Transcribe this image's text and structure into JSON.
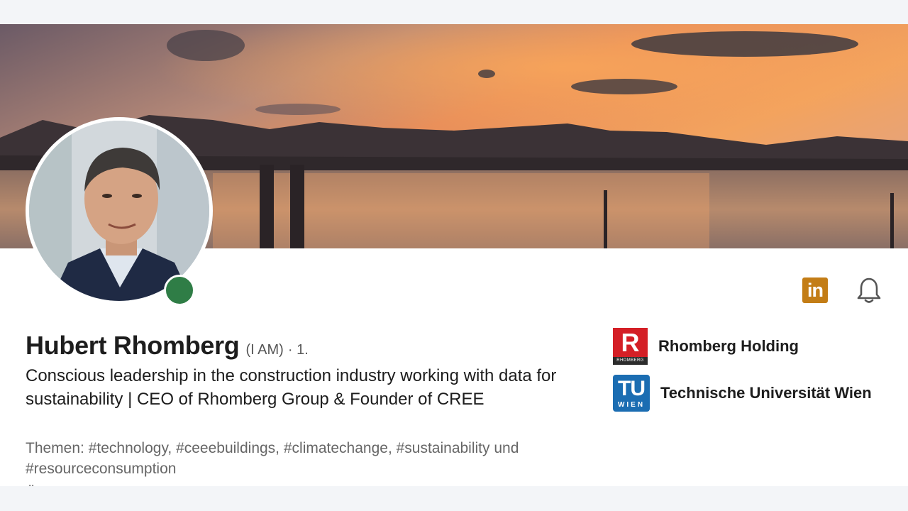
{
  "profile": {
    "name": "Hubert Rhomberg",
    "pronouns": "(I AM)",
    "degree": "· 1.",
    "headline": "Conscious leadership in the construction industry working with data for sustainability | CEO of Rhomberg Group & Founder of CREE",
    "topics": "Themen: #technology, #ceeebuildings, #climatechange, #sustainability und #resourceconsumption",
    "cutoff_text": "Ö"
  },
  "actions": {
    "linkedin_icon": "in",
    "bell_icon": "bell-icon"
  },
  "companies": [
    {
      "name": "Rhomberg Holding",
      "logo_letter": "R",
      "logo_word": "RHOMBERG"
    },
    {
      "name": "Technische Universität Wien",
      "logo_top": "TU",
      "logo_bottom": "WIEN"
    }
  ],
  "colors": {
    "presence": "#2f7d46",
    "linkedin_accent": "#c37d16",
    "rhomberg_red": "#d41f26",
    "tu_blue": "#1b6db2"
  }
}
